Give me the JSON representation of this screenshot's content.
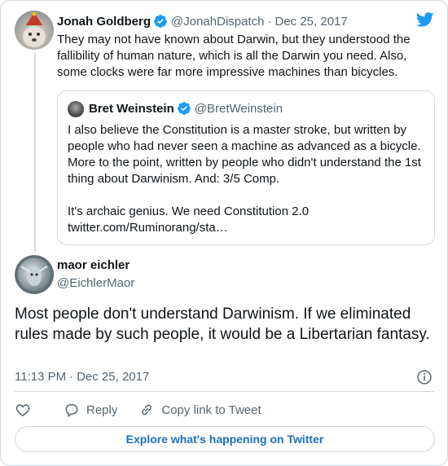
{
  "colors": {
    "accent": "#1d9bf0",
    "text": "#0f1419",
    "secondary": "#536471",
    "border": "#cfd9de",
    "link": "#1d6fb8"
  },
  "reply_tweet": {
    "author_name": "Jonah Goldberg",
    "author_handle": "@JonahDispatch",
    "separator": "·",
    "date": "Dec 25, 2017",
    "verified_icon": "verified-badge-icon",
    "text": "They may not have known about Darwin, but they understood the fallibility of human nature, which is all the Darwin you need. Also, some clocks were far more impressive machines than bicycles.",
    "quoted": {
      "author_name": "Bret Weinstein",
      "author_handle": "@BretWeinstein",
      "paragraph1": "I also believe the Constitution is a master stroke, but written by people who had never seen a machine as advanced as a bicycle. More to the point, written by people who didn't understand the 1st thing about Darwinism. And: 3/5 Comp.",
      "paragraph2": "It's archaic genius. We need Constitution 2.0",
      "link": "twitter.com/Ruminorang/sta…"
    }
  },
  "main_tweet": {
    "author_name": "maor eichler",
    "author_handle": "@EichlerMaor",
    "text": "Most people don't understand Darwinism. If we eliminated rules made by such people, it would be a Libertarian fantasy.",
    "time": "11:13 PM",
    "separator": "·",
    "date": "Dec 25, 2017"
  },
  "actions": {
    "like_icon": "heart-icon",
    "reply_label": "Reply",
    "copy_link_label": "Copy link to Tweet"
  },
  "explore_label": "Explore what's happening on Twitter",
  "icons": {
    "brand": "twitter-bird-icon",
    "info": "info-icon"
  }
}
